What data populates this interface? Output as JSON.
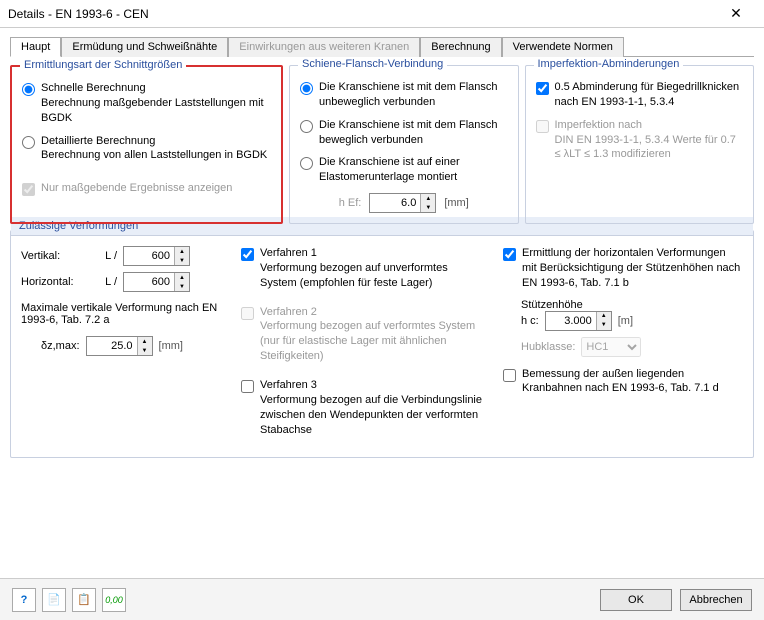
{
  "window": {
    "title": "Details - EN 1993-6 - CEN"
  },
  "tabs": {
    "items": [
      {
        "label": "Haupt",
        "active": true
      },
      {
        "label": "Ermüdung und Schweißnähte",
        "active": false
      },
      {
        "label": "Einwirkungen aus weiteren Kranen",
        "active": false,
        "disabled": true
      },
      {
        "label": "Berechnung",
        "active": false
      },
      {
        "label": "Verwendete Normen",
        "active": false
      }
    ]
  },
  "ermittlungsart": {
    "title": "Ermittlungsart der Schnittgrößen",
    "opt1": {
      "title": "Schnelle Berechnung",
      "sub": "Berechnung maßgebender Laststellungen mit BGDK",
      "checked": true
    },
    "opt2": {
      "title": "Detaillierte Berechnung",
      "sub": "Berechnung von allen Laststellungen in BGDK",
      "checked": false
    },
    "only": {
      "label": "Nur maßgebende Ergebnisse anzeigen",
      "checked": true
    }
  },
  "schiene": {
    "title": "Schiene-Flansch-Verbindung",
    "opt1": {
      "label": "Die Kranschiene ist mit dem Flansch unbeweglich verbunden",
      "checked": true
    },
    "opt2": {
      "label": "Die Kranschiene ist mit dem Flansch beweglich verbunden",
      "checked": false
    },
    "opt3": {
      "label": "Die Kranschiene ist auf einer Elastomerunterlage montiert",
      "checked": false
    },
    "hef_label": "h Ef:",
    "hef_value": "6.0",
    "hef_unit": "[mm]"
  },
  "imperfektion": {
    "title": "Imperfektion-Abminderungen",
    "chk1": {
      "label": "0.5 Abminderung für Biegedrillknicken nach EN 1993-1-1, 5.3.4",
      "checked": true
    },
    "chk2": {
      "label": "Imperfektion nach",
      "sub": "DIN EN 1993-1-1, 5.3.4 Werte für 0.7 ≤ λLT ≤ 1.3 modifizieren",
      "checked": false
    }
  },
  "verformungen": {
    "title": "Zulässige Verformungen",
    "vertikal": {
      "label": "Vertikal:",
      "prefix": "L /",
      "value": "600"
    },
    "horizontal": {
      "label": "Horizontal:",
      "prefix": "L /",
      "value": "600"
    },
    "max_note": "Maximale vertikale Verformung nach EN 1993-6, Tab. 7.2 a",
    "dz_label": "δz,max:",
    "dz_value": "25.0",
    "dz_unit": "[mm]",
    "verf1": {
      "checked": true,
      "title": "Verfahren 1",
      "sub": "Verformung bezogen auf unverformtes System (empfohlen für feste Lager)"
    },
    "verf2": {
      "checked": false,
      "title": "Verfahren 2",
      "sub": "Verformung bezogen auf verformtes System (nur für elastische Lager mit ähnlichen Steifigkeiten)"
    },
    "verf3": {
      "checked": false,
      "title": "Verfahren 3",
      "sub": "Verformung bezogen auf die Verbindungslinie zwischen den Wendepunkten der verformten Stabachse"
    },
    "horiz_chk": {
      "checked": true,
      "label": "Ermittlung der horizontalen Verformungen mit Berücksichtigung der Stützenhöhen nach EN 1993-6, Tab. 7.1 b"
    },
    "stuetze_label": "Stützenhöhe",
    "hc_label": "h c:",
    "hc_value": "3.000",
    "hc_unit": "[m]",
    "hubklasse_label": "Hubklasse:",
    "hubklasse_value": "HC1",
    "bemessung": {
      "checked": false,
      "label": "Bemessung der außen liegenden Kranbahnen nach EN 1993-6, Tab. 7.1 d"
    }
  },
  "footer": {
    "ok": "OK",
    "cancel": "Abbrechen"
  }
}
